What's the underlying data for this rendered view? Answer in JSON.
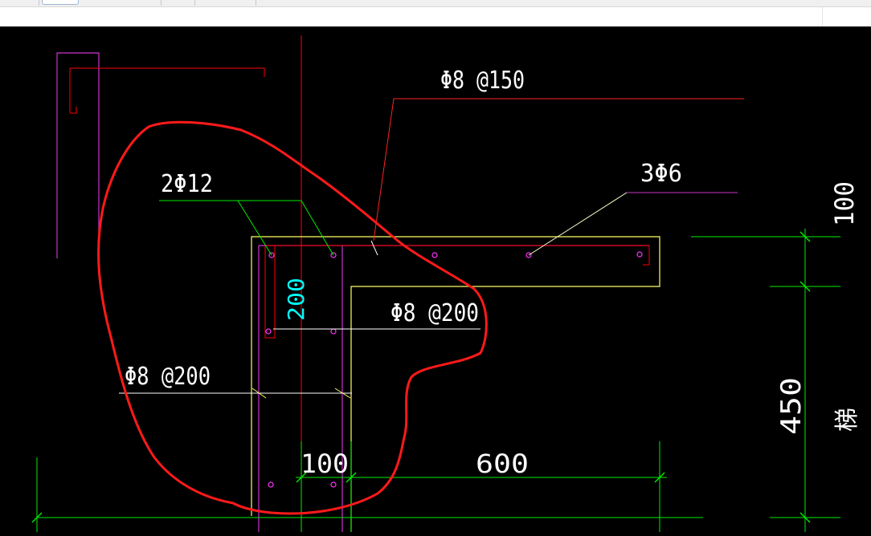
{
  "window": {
    "toolbar_tabs": [
      "",
      "",
      "",
      ""
    ]
  },
  "drawing": {
    "background_color": "#000000",
    "annotations": {
      "top_stirrup_label": "Φ8 @150",
      "top_bars_label": "2Φ12",
      "right_bars_label": "3Φ6",
      "mid_stirrup_label": "Φ8 @200",
      "left_stirrup_label": "Φ8 @200",
      "column_width_label": "200"
    },
    "dimensions": {
      "bottom_left": "100",
      "bottom_right": "600",
      "right_top": "100",
      "right_middle": "450",
      "right_edge_partial": "梯"
    },
    "colors": {
      "red": "#ff0000",
      "yellow": "#ffff66",
      "magenta": "#cc33cc",
      "green": "#00ee00",
      "cyan": "#00ffff",
      "white": "#ffffff",
      "highlight_circle": "#ff1a1a"
    }
  }
}
